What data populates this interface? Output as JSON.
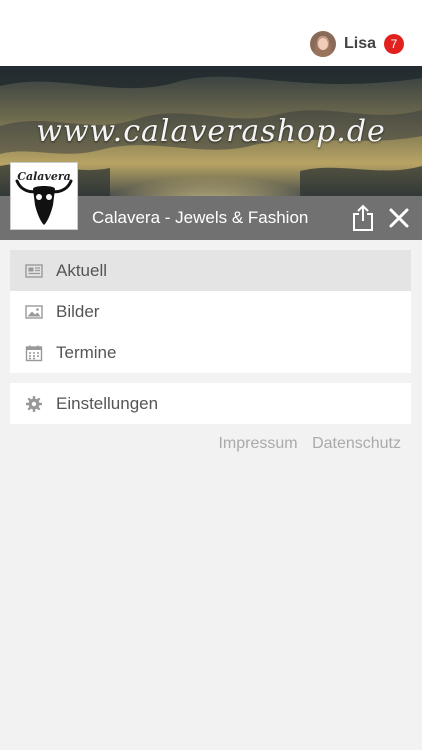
{
  "header": {
    "username": "Lisa",
    "notification_count": "7"
  },
  "banner": {
    "url_text": "www.calaverashop.de"
  },
  "app": {
    "logo_text": "Calavera",
    "title": "Calavera - Jewels & Fashion"
  },
  "menu": {
    "items": [
      {
        "label": "Aktuell",
        "icon": "newspaper-icon",
        "active": true
      },
      {
        "label": "Bilder",
        "icon": "image-icon",
        "active": false
      },
      {
        "label": "Termine",
        "icon": "calendar-icon",
        "active": false
      }
    ],
    "settings": {
      "label": "Einstellungen",
      "icon": "gear-icon"
    }
  },
  "footer": {
    "impressum": "Impressum",
    "datenschutz": "Datenschutz"
  },
  "colors": {
    "badge": "#e0211e",
    "titlebar": "#717171",
    "active_item": "#e4e4e4"
  }
}
